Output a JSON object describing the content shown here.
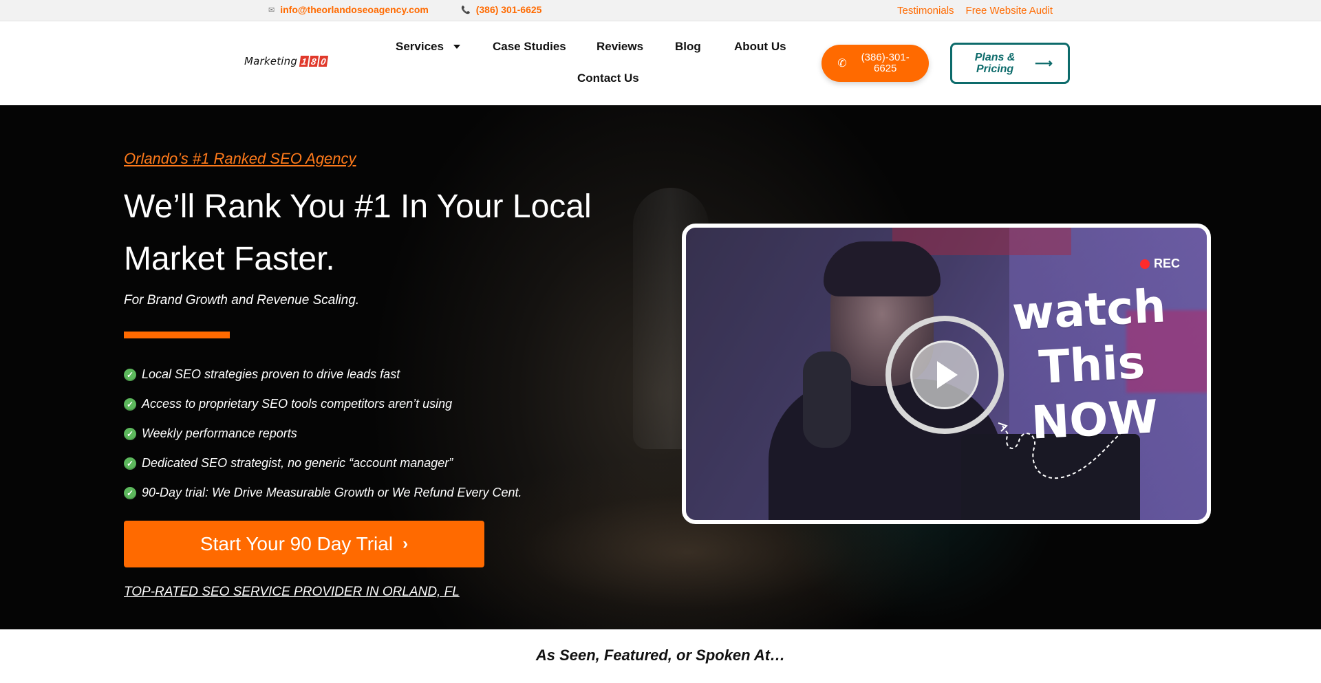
{
  "topbar": {
    "email": "info@theorlandoseoagency.com",
    "phone": "(386) 301-6625",
    "links": [
      "Testimonials",
      "Free Website Audit"
    ]
  },
  "header": {
    "logo": {
      "word": "Marketing",
      "digits": [
        "1",
        "8",
        "0"
      ]
    },
    "nav": {
      "services": "Services",
      "case_studies": "Case Studies",
      "reviews": "Reviews",
      "blog": "Blog",
      "about": "About Us",
      "contact": "Contact Us"
    },
    "call_button": "(386)-301-6625",
    "plans_button": "Plans & Pricing"
  },
  "hero": {
    "tagline": "Orlando’s #1 Ranked SEO Agency",
    "headline": "We’ll Rank You #1 In Your Local Market Faster.",
    "subhead": "For Brand Growth and Revenue Scaling.",
    "bullets": [
      "Local SEO strategies proven to drive leads fast",
      "Access to proprietary SEO tools competitors aren’t using",
      "Weekly performance reports",
      "Dedicated SEO strategist, no generic “account manager”",
      "90-Day trial: We Drive Measurable Growth or We Refund Every Cent."
    ],
    "cta": "Start Your 90 Day Trial",
    "top_rated": "TOP-RATED SEO SERVICE PROVIDER IN ORLAND, FL"
  },
  "video": {
    "rec_label": "REC",
    "watch_lines": [
      "watch",
      "This",
      "NOW"
    ]
  },
  "as_seen": "As Seen, Featured, or Spoken At…",
  "colors": {
    "accent": "#ff6a00",
    "teal": "#0d6b6b",
    "check": "#5cb85c"
  },
  "icons": {
    "email": "envelope-icon",
    "phone": "phone-icon",
    "check": "check-circle-icon",
    "play": "play-icon"
  }
}
